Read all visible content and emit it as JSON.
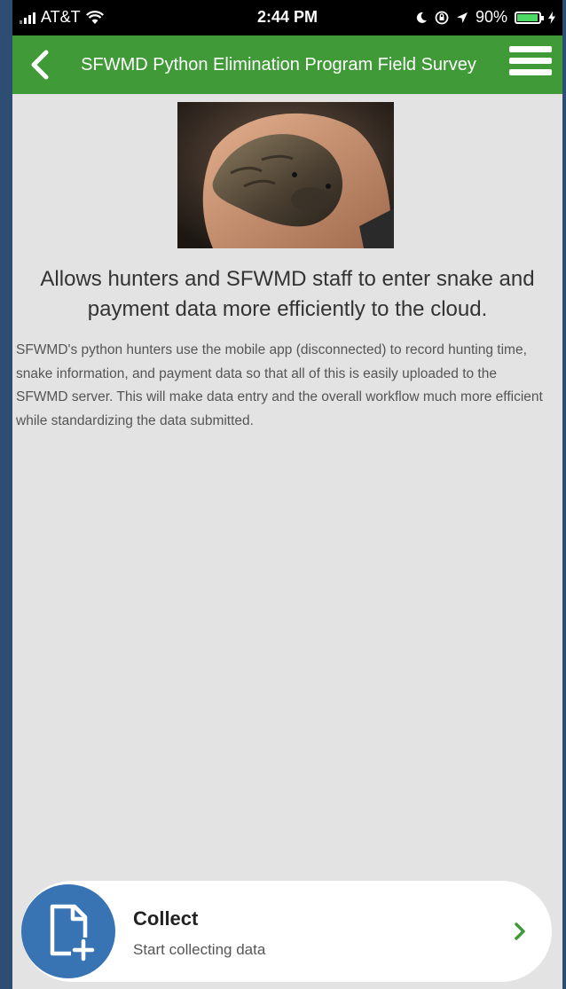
{
  "status_bar": {
    "carrier": "AT&T",
    "time": "2:44 PM",
    "battery": "90%",
    "battery_level": 0.9
  },
  "app_bar": {
    "title": "SFWMD Python Elimination Program Field Survey",
    "back_icon": "chevron-left-icon",
    "menu_icon": "hamburger-menu-icon"
  },
  "hero_image": {
    "subject": "python-head-photo"
  },
  "content": {
    "headline": "Allows hunters and SFWMD staff to enter snake and payment data more efficiently to the cloud.",
    "description": "SFWMD's python hunters use the mobile app (disconnected) to record hunting time, snake information, and payment data so that all of this is easily uploaded to the SFWMD server. This will make data entry and the overall workflow much more efficient while standardizing the data submitted."
  },
  "collect": {
    "title": "Collect",
    "subtitle": "Start collecting data",
    "icon": "add-document-icon",
    "chevron_icon": "chevron-right-icon"
  },
  "colors": {
    "app_bar": "#3f9a37",
    "accent_blue": "#3874b4",
    "page_background": "#e3e3e3",
    "outer_background": "#2d4d72"
  }
}
